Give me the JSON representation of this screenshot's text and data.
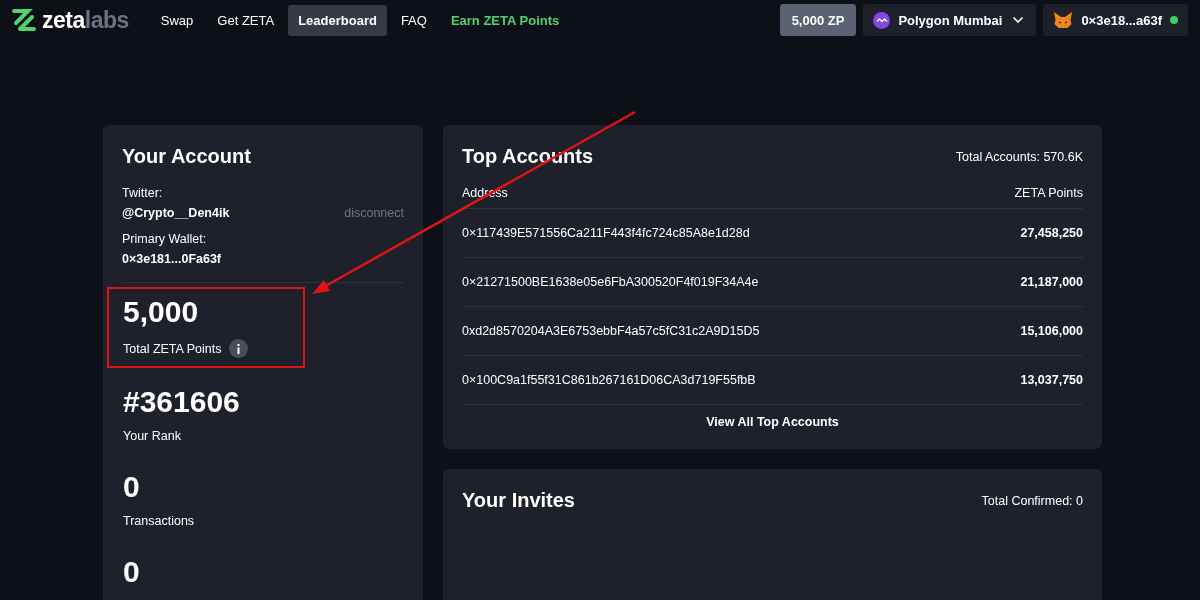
{
  "logo": {
    "primary": "zeta",
    "secondary": "labs"
  },
  "nav": [
    {
      "label": "Swap",
      "selected": false,
      "kind": "plain"
    },
    {
      "label": "Get ZETA",
      "selected": false,
      "kind": "plain"
    },
    {
      "label": "Leaderboard",
      "selected": true,
      "kind": "plain"
    },
    {
      "label": "FAQ",
      "selected": false,
      "kind": "plain"
    },
    {
      "label": "Earn ZETA Points",
      "selected": false,
      "kind": "accent"
    }
  ],
  "points_badge": "5,000 ZP",
  "network": {
    "label": "Polygon Mumbai"
  },
  "wallet": {
    "address": "0×3e18...a63f",
    "connected": true
  },
  "account": {
    "title": "Your Account",
    "twitter_label": "Twitter:",
    "twitter_handle": "@Crypto__Den4ik",
    "disconnect": "disconnect",
    "wallet_label": "Primary Wallet:",
    "wallet_address": "0×3e181...0Fa63f",
    "stats": [
      {
        "value": "5,000",
        "label": "Total ZETA Points",
        "info": true,
        "highlighted": true
      },
      {
        "value": "#361606",
        "label": "Your Rank",
        "info": false,
        "highlighted": false
      },
      {
        "value": "0",
        "label": "Transactions",
        "info": false,
        "highlighted": false
      },
      {
        "value": "0",
        "info": false,
        "highlighted": false
      }
    ]
  },
  "top_accounts": {
    "title": "Top Accounts",
    "total": "Total Accounts: 570.6K",
    "columns": [
      "Address",
      "ZETA Points"
    ],
    "rows": [
      {
        "address": "0×117439E571556Ca211F443f4fc724c85A8e1d28d",
        "points": "27,458,250"
      },
      {
        "address": "0×21271500BE1638e05e6FbA300520F4f019F34A4e",
        "points": "21,187,000"
      },
      {
        "address": "0xd2d8570204A3E6753ebbF4a57c5fC31c2A9D15D5",
        "points": "15,106,000"
      },
      {
        "address": "0×100C9a1f55f31C861b267161D06CA3d719F55fbB",
        "points": "13,037,750"
      }
    ],
    "view_all": "View All Top Accounts"
  },
  "invites": {
    "title": "Your Invites",
    "total": "Total Confirmed: 0"
  },
  "annotation_arrow": true
}
